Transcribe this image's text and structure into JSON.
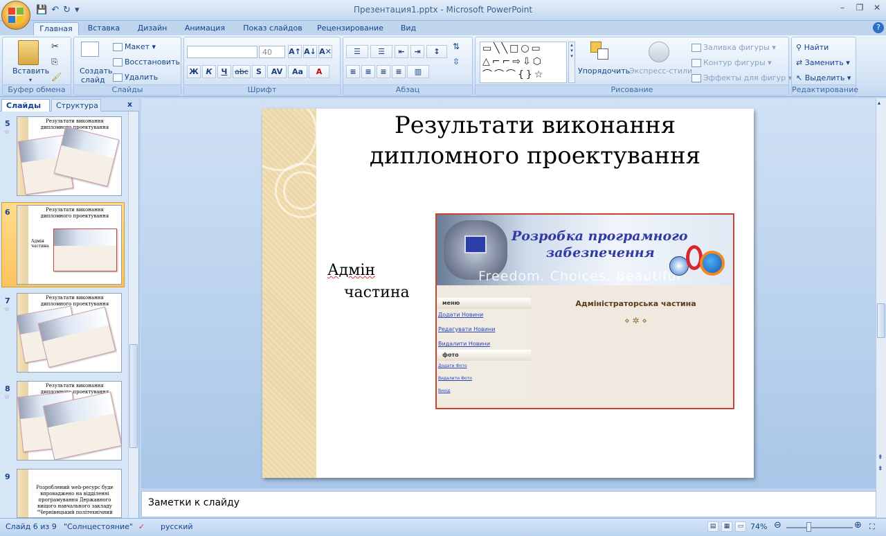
{
  "window": {
    "title": "Презентация1.pptx - Microsoft PowerPoint",
    "minimize": "–",
    "restore": "❐",
    "close": "✕"
  },
  "qat": {
    "save": "💾",
    "undo": "↶",
    "redo": "↻",
    "more": "▾"
  },
  "tabs": [
    "Главная",
    "Вставка",
    "Дизайн",
    "Анимация",
    "Показ слайдов",
    "Рецензирование",
    "Вид"
  ],
  "ribbon": {
    "clipboard": {
      "paste": "Вставить",
      "label": "Буфер обмена"
    },
    "slides": {
      "create": "Создать",
      "create2": "слайд",
      "layout": "Макет",
      "reset": "Восстановить",
      "delete": "Удалить",
      "label": "Слайды"
    },
    "font": {
      "font_name": "",
      "font_size": "40",
      "bold": "Ж",
      "italic": "К",
      "underline": "Ч",
      "strike": "abc",
      "shadow": "S",
      "spacing": "AV",
      "case": "Aa",
      "color": "A",
      "grow": "A↑",
      "shrink": "A↓",
      "clear": "A✕",
      "label": "Шрифт"
    },
    "paragraph": {
      "label": "Абзац"
    },
    "drawing": {
      "arrange": "Упорядочить",
      "styles": "Экспресс-стили",
      "fill": "Заливка фигуры",
      "outline": "Контур фигуры",
      "effects": "Эффекты для фигур",
      "label": "Рисование"
    },
    "editing": {
      "find": "Найти",
      "replace": "Заменить",
      "select": "Выделить",
      "label": "Редактирование"
    }
  },
  "panel": {
    "tab_slides": "Слайды",
    "tab_outline": "Структура",
    "close": "x"
  },
  "thumbs": [
    {
      "num": "5",
      "title": "Результати виконання дипломного проектування"
    },
    {
      "num": "6",
      "title": "Результати виконання дипломного проектування",
      "body": "Адмін частина"
    },
    {
      "num": "7",
      "title": "Результати виконання дипломного проектування"
    },
    {
      "num": "8",
      "title": "Результати виконання дипломного проектування"
    },
    {
      "num": "9",
      "text": "Розроблений web-ресурс буде впроваджено на відділенні програмування Державного вищого навчального закладу \"Чернівецький політехнічний"
    }
  ],
  "slide": {
    "title": "Результати виконання дипломного проектування",
    "body_line1": "Адмін",
    "body_line2": "частина",
    "banner_line1": "Розробка програмного",
    "banner_line2": "забезпечення",
    "banner_watermark": "Freedom. Choices. Beautiful",
    "menu_header": "меню",
    "menu_items": [
      "Додати Новини",
      "Редагувати Новини",
      "Видалити Новини"
    ],
    "photo_header": "фото",
    "photo_items": [
      "Додати Фото",
      "Видалити Фото",
      "Вихід"
    ],
    "admin_heading": "Адміністраторська частина",
    "ornament": "⋄ ✲ ⋄"
  },
  "notes": {
    "placeholder": "Заметки к слайду"
  },
  "status": {
    "slide": "Слайд 6 из 9",
    "theme": "\"Солнцестояние\"",
    "lang": "русский",
    "zoom": "74%"
  }
}
